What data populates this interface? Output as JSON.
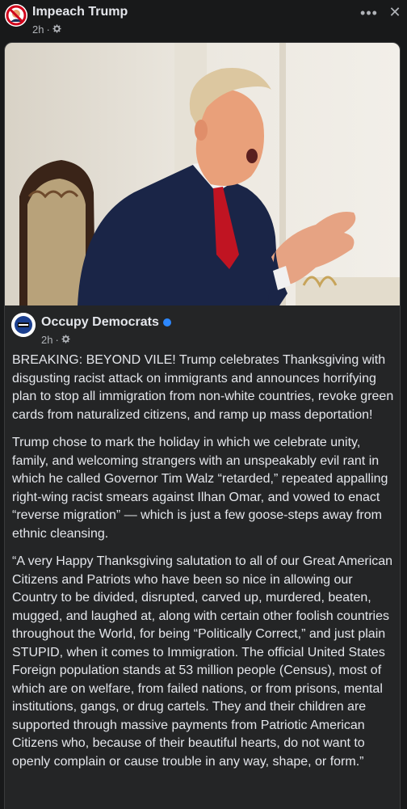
{
  "post": {
    "page_name": "Impeach Trump",
    "time": "2h",
    "audience_icon": "gear-icon",
    "more_icon": "more-options-icon",
    "close_icon": "close-icon"
  },
  "shared": {
    "page_name": "Occupy Democrats",
    "time": "2h",
    "verified_icon": "verified-badge-icon",
    "photo_icon": "post-photo",
    "paragraphs": [
      "BREAKING: BEYOND VILE! Trump celebrates Thanksgiving with disgusting racist attack on immigrants and announces horrifying plan to stop all immigration from non-white countries, revoke green cards from naturalized citizens, and ramp up mass deportation!",
      "Trump chose to mark the holiday in which we celebrate unity, family, and welcoming strangers with an unspeakably evil rant in which he called Governor Tim Walz “retarded,” repeated appalling right-wing racist smears against Ilhan Omar, and vowed to enact “reverse migration” — which is just a few goose-steps away from ethnic cleansing.",
      "“A very Happy Thanksgiving salutation to all of our Great American Citizens and Patriots who have been so nice in allowing our Country to be divided, disrupted, carved up, murdered, beaten, mugged, and laughed at, along with certain other foolish countries throughout the World, for being “Politically Correct,” and just plain STUPID, when it comes to Immigration. The official United States Foreign population stands at 53 million people (Census), most of which are on welfare, from failed nations, or from prisons, mental institutions, gangs, or drug cartels. They and their children are supported through massive payments from Patriotic American Citizens who, because of their beautiful hearts, do not want to openly complain or cause trouble in any way, shape, or form.”"
    ]
  },
  "colors": {
    "background": "#18191a",
    "card": "#242526",
    "text": "#e4e6eb",
    "secondary_text": "#b0b3b8",
    "verified": "#2d88ff"
  }
}
